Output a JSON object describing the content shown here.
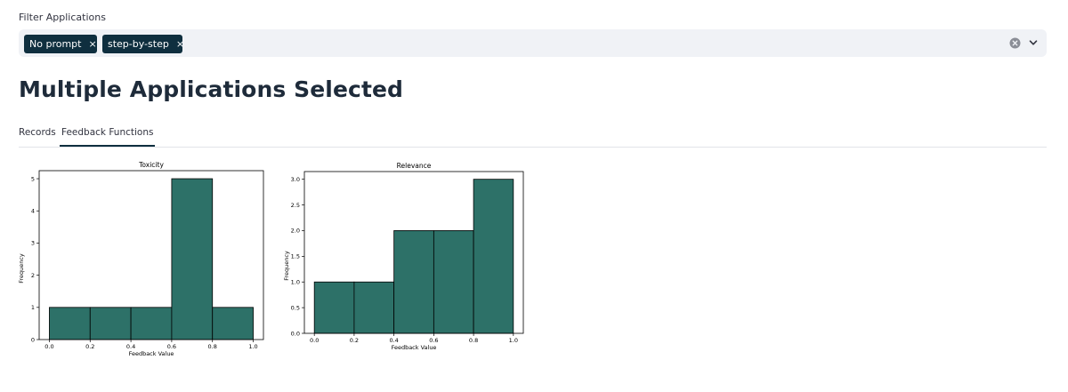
{
  "filter": {
    "label": "Filter Applications",
    "chips": [
      {
        "label": "No prompt",
        "remove": "×"
      },
      {
        "label": "step-by-step",
        "remove": "×"
      }
    ],
    "chip_color": "#0f2f3f",
    "icons": {
      "clear": "clear-circle-icon",
      "expand": "chevron-down-icon"
    }
  },
  "page": {
    "title": "Multiple Applications Selected"
  },
  "tabs": {
    "items": [
      {
        "label": "Records",
        "active": false
      },
      {
        "label": "Feedback Functions",
        "active": true
      }
    ]
  },
  "chart_data": [
    {
      "type": "bar",
      "title": "Toxicity",
      "xlabel": "Feedback Value",
      "ylabel": "Frequency",
      "bins": [
        0.0,
        0.2,
        0.4,
        0.6,
        0.8,
        1.0
      ],
      "values": [
        1,
        1,
        1,
        5,
        1
      ],
      "xlim": [
        -0.05,
        1.05
      ],
      "ylim": [
        0,
        5.25
      ],
      "xticks": [
        "0.0",
        "0.2",
        "0.4",
        "0.6",
        "0.8",
        "1.0"
      ],
      "yticks": [
        "0",
        "1",
        "2",
        "3",
        "4",
        "5"
      ],
      "ytick_values": [
        0,
        1,
        2,
        3,
        4,
        5
      ],
      "bar_color": "#2d7168",
      "grid": false
    },
    {
      "type": "bar",
      "title": "Relevance",
      "xlabel": "Feedback Value",
      "ylabel": "Frequency",
      "bins": [
        0.0,
        0.2,
        0.4,
        0.6,
        0.8,
        1.0
      ],
      "values": [
        1,
        1,
        2,
        2,
        3
      ],
      "xlim": [
        -0.05,
        1.05
      ],
      "ylim": [
        0,
        3.15
      ],
      "xticks": [
        "0.0",
        "0.2",
        "0.4",
        "0.6",
        "0.8",
        "1.0"
      ],
      "yticks": [
        "0.0",
        "0.5",
        "1.0",
        "1.5",
        "2.0",
        "2.5",
        "3.0"
      ],
      "ytick_values": [
        0,
        0.5,
        1,
        1.5,
        2,
        2.5,
        3
      ],
      "bar_color": "#2d7168",
      "grid": false
    }
  ]
}
